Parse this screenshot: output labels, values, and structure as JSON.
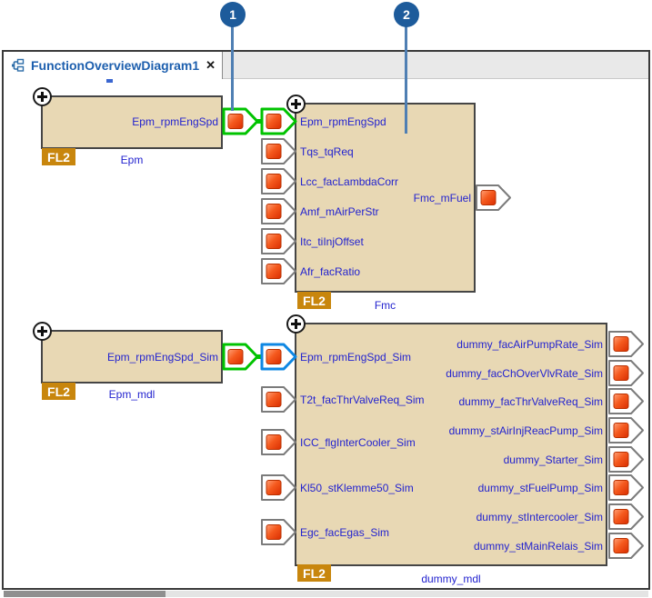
{
  "tab": {
    "title": "FunctionOverviewDiagram1",
    "close_label": "✕"
  },
  "callouts": [
    {
      "number": "1"
    },
    {
      "number": "2"
    }
  ],
  "blocks": {
    "epm": {
      "name": "Epm",
      "badge": "FL2",
      "outputs": [
        "Epm_rpmEngSpd"
      ]
    },
    "fmc": {
      "name": "Fmc",
      "badge": "FL2",
      "inputs": [
        "Epm_rpmEngSpd",
        "Tqs_tqReq",
        "Lcc_facLambdaCorr",
        "Amf_mAirPerStr",
        "Itc_tiInjOffset",
        "Afr_facRatio"
      ],
      "outputs": [
        "Fmc_mFuel"
      ]
    },
    "epm_mdl": {
      "name": "Epm_mdl",
      "badge": "FL2",
      "outputs": [
        "Epm_rpmEngSpd_Sim"
      ]
    },
    "dummy_mdl": {
      "name": "dummy_mdl",
      "badge": "FL2",
      "inputs": [
        "Epm_rpmEngSpd_Sim",
        "T2t_facThrValveReq_Sim",
        "ICC_flgInterCooler_Sim",
        "Kl50_stKlemme50_Sim",
        "Egc_facEgas_Sim"
      ],
      "outputs": [
        "dummy_facAirPumpRate_Sim",
        "dummy_facChOverVlvRate_Sim",
        "dummy_facThrValveReq_Sim",
        "dummy_stAirInjReacPump_Sim",
        "dummy_Starter_Sim",
        "dummy_stFuelPump_Sim",
        "dummy_stIntercooler_Sim",
        "dummy_stMainRelais_Sim"
      ]
    }
  },
  "colors": {
    "block_fill": "#e8d8b4",
    "block_border": "#454545",
    "label_blue": "#2323cf",
    "badge_orange": "#c8860d",
    "port_square": "#f55a1e",
    "highlight_green": "#00c300",
    "highlight_blue": "#0e87e3",
    "callout_blue": "#1d5b9b",
    "tab_title_blue": "#1d5fae"
  },
  "icons": {
    "tab": "diagram-icon",
    "close": "close-icon",
    "expand": "plus-icon",
    "port": "port-arrow-icon"
  }
}
